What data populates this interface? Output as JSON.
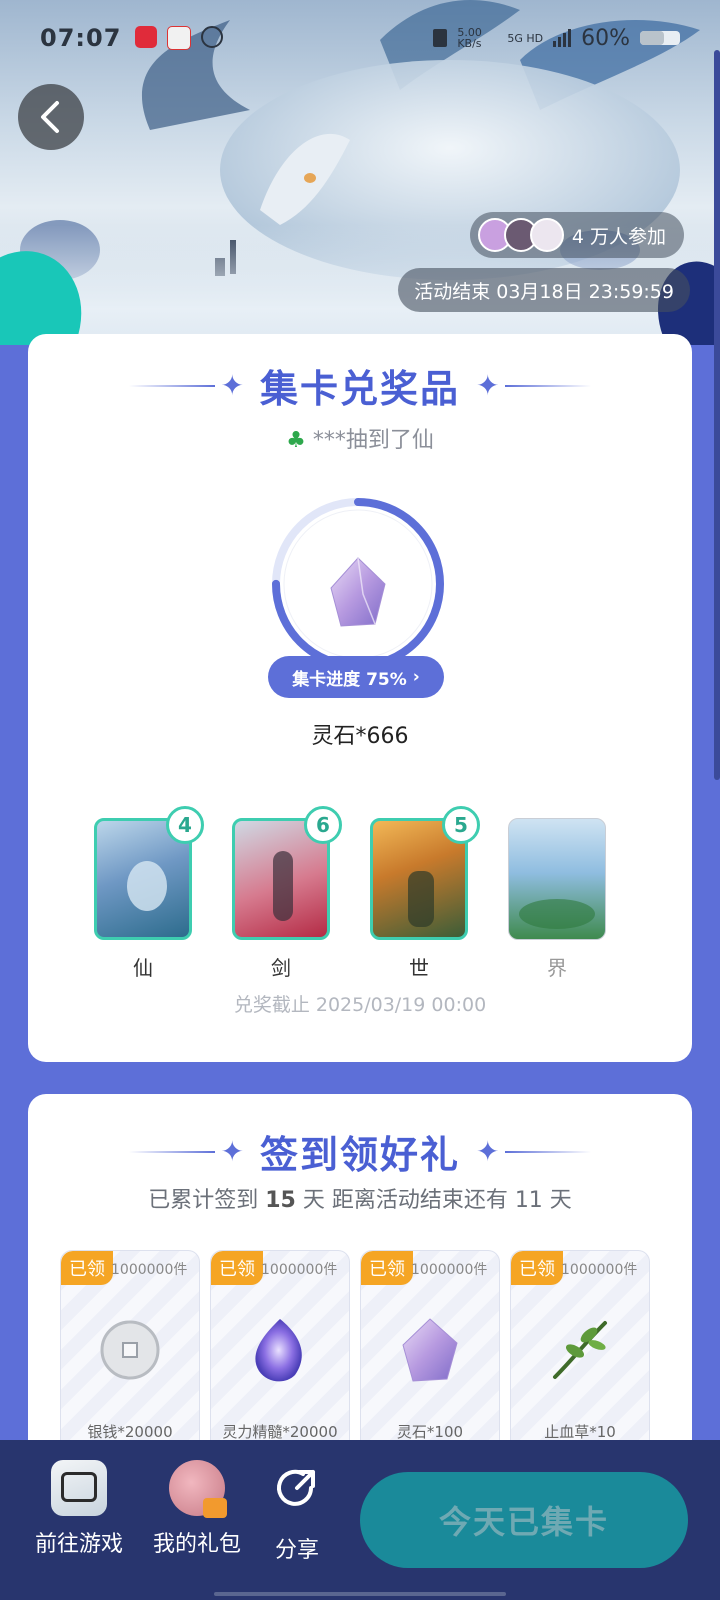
{
  "status_bar": {
    "time": "07:07",
    "net_speed": "5.00 KB/s",
    "network": "5G HD",
    "battery": "60%"
  },
  "hero": {
    "participants": "4 万人参加",
    "end_time": "活动结束 03月18日 23:59:59"
  },
  "collect_section": {
    "title": "集卡兑奖品",
    "winner_text": "***抽到了仙",
    "progress_label": "集卡进度 75%",
    "progress_value": 0.75,
    "reward": "灵石*666",
    "cards": [
      {
        "label": "仙",
        "count": "4"
      },
      {
        "label": "剑",
        "count": "6"
      },
      {
        "label": "世",
        "count": "5"
      },
      {
        "label": "界",
        "count": ""
      }
    ],
    "deadline": "兑奖截止 2025/03/19 00:00"
  },
  "checkin_section": {
    "title": "签到领好礼",
    "prefix": "已累计签到",
    "days": "15",
    "mid": "天  距离活动结束还有 11 天",
    "gifts": [
      {
        "tag": "已领",
        "qty": "1000000件",
        "name": "银钱*20000"
      },
      {
        "tag": "已领",
        "qty": "1000000件",
        "name": "灵力精髓*20000"
      },
      {
        "tag": "已领",
        "qty": "1000000件",
        "name": "灵石*100"
      },
      {
        "tag": "已领",
        "qty": "1000000件",
        "name": "止血草*10"
      }
    ]
  },
  "bottom_bar": {
    "go_game": "前往游戏",
    "my_gifts": "我的礼包",
    "share": "分享",
    "collect_button": "今天已集卡"
  },
  "colors": {
    "accent": "#5d6fd8",
    "teal": "#3ecdb0",
    "orange_tag": "#f5a524",
    "bottom_bar": "#28356e"
  }
}
